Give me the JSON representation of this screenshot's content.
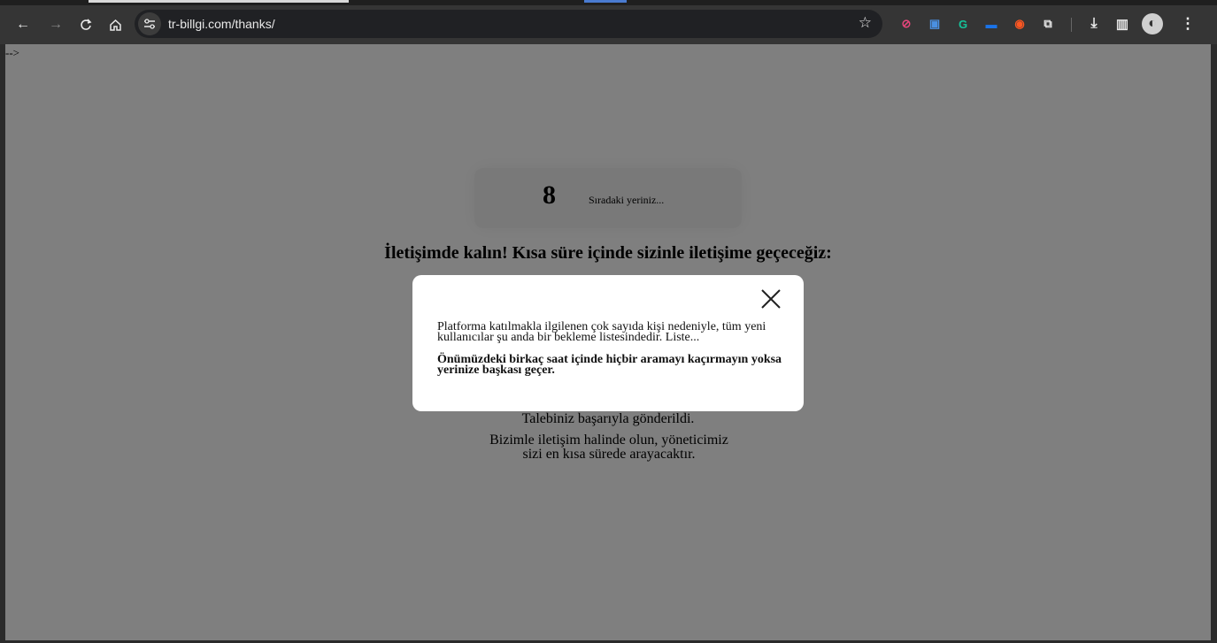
{
  "browser": {
    "url": "tr-billgi.com/thanks/",
    "back_icon": "←",
    "forward_icon": "→",
    "reload_icon": "C",
    "home_icon": "⌂",
    "site_info_icon": "⚙",
    "star_icon": "☆",
    "extensions": [
      {
        "name": "ext-1-icon",
        "glyph": "⊘",
        "color": "#e8467c"
      },
      {
        "name": "ext-2-icon",
        "glyph": "▣",
        "color": "#4a90e2"
      },
      {
        "name": "grammarly-icon",
        "glyph": "G",
        "color": "#15c39a"
      },
      {
        "name": "ext-4-icon",
        "glyph": "▬",
        "color": "#1a73e8"
      },
      {
        "name": "ext-5-icon",
        "glyph": "◉",
        "color": "#ff5722"
      },
      {
        "name": "puzzle-icon",
        "glyph": "⧉",
        "color": "#e8e8e8"
      }
    ],
    "download_icon": "⤓",
    "sidepanel_icon": "▥",
    "profile_icon": "◐",
    "menu_icon": "⋮"
  },
  "page": {
    "comment_artifact": "-->",
    "counter": {
      "number": "8",
      "label": "Sıradaki yeriniz..."
    },
    "heading": "İletişimde kalın! Kısa süre içinde sizinle iletişime geçeceğiz:",
    "success_line": "Talebiniz başarıyla gönderildi.",
    "contact_line": "Bizimle iletişim halinde olun, yöneticimiz sizi en kısa sürede arayacaktır."
  },
  "modal": {
    "close_icon": "×",
    "text": "Platforma katılmakla ilgilenen çok sayıda kişi nedeniyle, tüm yeni kullanıcılar şu anda bir bekleme listesindedir. Liste...",
    "bold_text": "Önümüzdeki birkaç saat içinde hiçbir aramayı kaçırmayın yoksa yerinize başkası geçer."
  }
}
